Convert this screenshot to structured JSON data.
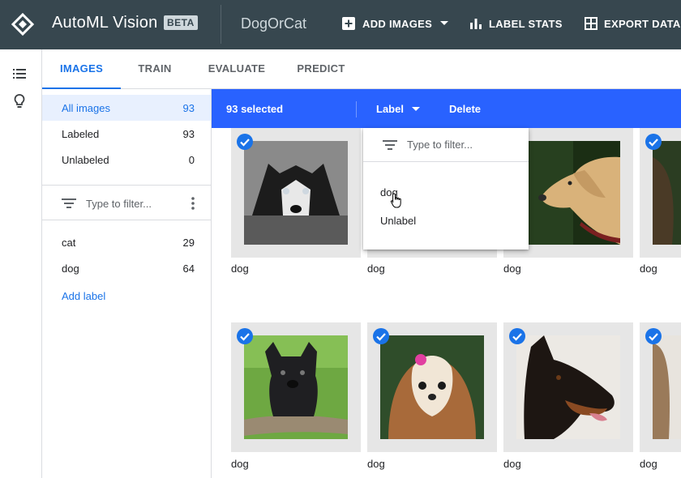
{
  "topbar": {
    "app_title": "AutoML Vision",
    "beta_badge": "BETA",
    "dataset_name": "DogOrCat",
    "add_images": "ADD IMAGES",
    "label_stats": "LABEL STATS",
    "export_data": "EXPORT DATA",
    "bg_color": "#37474f"
  },
  "rail": {
    "icons": [
      "list-icon",
      "lightbulb-icon"
    ]
  },
  "tabs": [
    "IMAGES",
    "TRAIN",
    "EVALUATE",
    "PREDICT"
  ],
  "active_tab": "IMAGES",
  "panel": {
    "filters": [
      {
        "label": "All images",
        "count": "93"
      },
      {
        "label": "Labeled",
        "count": "93"
      },
      {
        "label": "Unlabeled",
        "count": "0"
      }
    ],
    "label_filter_placeholder": "Type to filter...",
    "labels": [
      {
        "label": "cat",
        "count": "29"
      },
      {
        "label": "dog",
        "count": "64"
      }
    ],
    "add_label": "Add label"
  },
  "selection_bar": {
    "selected_text": "93 selected",
    "label_button": "Label",
    "delete_button": "Delete",
    "color": "#2962ff"
  },
  "label_menu": {
    "filter_placeholder": "Type to filter...",
    "options": [
      "dog",
      "Unlabel"
    ]
  },
  "images": [
    {
      "caption": "dog",
      "subject": "husky-photo"
    },
    {
      "caption": "dog",
      "subject": "hidden-under-menu"
    },
    {
      "caption": "dog",
      "subject": "labrador-photo"
    },
    {
      "caption": "dog",
      "subject": "dog-photo-partial"
    },
    {
      "caption": "dog",
      "subject": "french-bulldog-photo"
    },
    {
      "caption": "dog",
      "subject": "shih-tzu-photo"
    },
    {
      "caption": "dog",
      "subject": "doberman-photo"
    },
    {
      "caption": "dog",
      "subject": "dog-photo-partial"
    }
  ],
  "accent_color": "#1a73e8"
}
